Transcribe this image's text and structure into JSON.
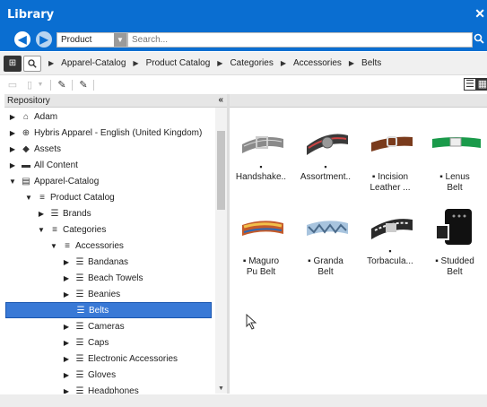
{
  "window": {
    "title": "Library",
    "close_icon": "close-icon"
  },
  "search": {
    "type_value": "Product",
    "placeholder": "Search...",
    "back_icon": "arrow-left-icon",
    "forward_icon": "arrow-right-icon",
    "search_icon": "magnifier-icon"
  },
  "breadcrumb": {
    "icons": [
      "tree-view-icon",
      "search-view-icon"
    ],
    "items": [
      "Apparel-Catalog",
      "Product Catalog",
      "Categories",
      "Accessories",
      "Belts"
    ]
  },
  "toolbar": {
    "icons": [
      "folder-icon",
      "file-icon",
      "dropdown-icon",
      "pencil-icon",
      "edit-multiple-icon"
    ],
    "view_icons": [
      "list-view-icon",
      "grid-view-icon"
    ],
    "active_view": "grid-view-icon"
  },
  "tree": {
    "header": "Repository",
    "collapse_label": "«",
    "nodes": [
      {
        "label": "Adam",
        "icon": "home-icon",
        "expanded": false
      },
      {
        "label": "Hybris Apparel - English (United Kingdom)",
        "icon": "globe-icon",
        "expanded": false
      },
      {
        "label": "Assets",
        "icon": "cube-icon",
        "expanded": false
      },
      {
        "label": "All Content",
        "icon": "folder-icon",
        "expanded": false
      },
      {
        "label": "Apparel-Catalog",
        "icon": "catalog-icon",
        "expanded": true
      },
      {
        "label": "Product Catalog",
        "icon": "catalog-list-icon",
        "expanded": true
      },
      {
        "label": "Brands",
        "icon": "list-icon",
        "expanded": false
      },
      {
        "label": "Categories",
        "icon": "catalog-list-icon",
        "expanded": true
      },
      {
        "label": "Accessories",
        "icon": "catalog-list-icon",
        "expanded": true
      },
      {
        "label": "Bandanas",
        "icon": "list-icon",
        "expanded": false
      },
      {
        "label": "Beach Towels",
        "icon": "list-icon",
        "expanded": false
      },
      {
        "label": "Beanies",
        "icon": "list-icon",
        "expanded": false
      },
      {
        "label": "Belts",
        "icon": "list-icon",
        "expanded": false,
        "selected": true
      },
      {
        "label": "Cameras",
        "icon": "list-icon",
        "expanded": false
      },
      {
        "label": "Caps",
        "icon": "list-icon",
        "expanded": false
      },
      {
        "label": "Electronic Accessories",
        "icon": "list-icon",
        "expanded": false
      },
      {
        "label": "Gloves",
        "icon": "list-icon",
        "expanded": false
      },
      {
        "label": "Headphones",
        "icon": "list-icon",
        "expanded": false
      }
    ]
  },
  "products": [
    {
      "name_line1": "Handshake..",
      "name_line2": "",
      "color": "#7a7a7a"
    },
    {
      "name_line1": "Assortment..",
      "name_line2": "",
      "color": "#4a4a4a"
    },
    {
      "name_line1": "Incision",
      "name_line2": "Leather  ...",
      "color": "#7a3b1c",
      "inline_icon": true
    },
    {
      "name_line1": "Lenus",
      "name_line2": "Belt",
      "color": "#1a9a4a",
      "inline_icon": true
    },
    {
      "name_line1": "Maguro",
      "name_line2": "Pu Belt",
      "color": "#c45a2a",
      "inline_icon": true
    },
    {
      "name_line1": "Granda",
      "name_line2": "Belt",
      "color": "#5a8ab8",
      "inline_icon": true
    },
    {
      "name_line1": "Torbacula...",
      "name_line2": "",
      "color": "#2a2a2a"
    },
    {
      "name_line1": "Studded",
      "name_line2": "Belt",
      "color": "#111111",
      "inline_icon": true
    }
  ],
  "colors": {
    "accent": "#0a6ed1",
    "selection": "#3979d6"
  }
}
